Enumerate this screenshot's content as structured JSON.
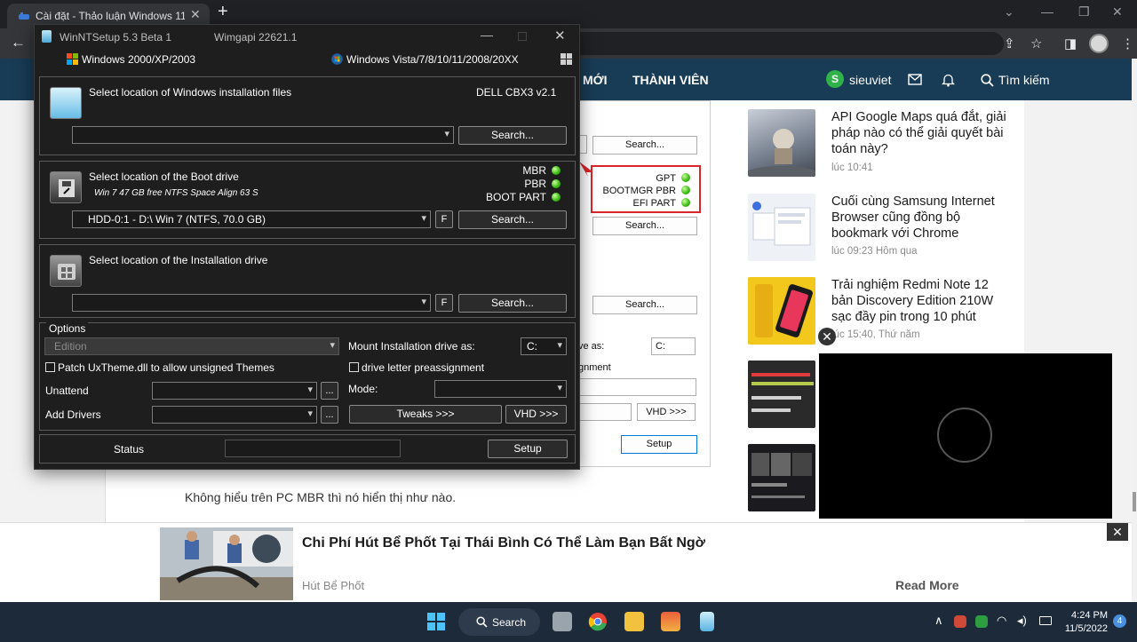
{
  "browser": {
    "tab_title": "Cài đặt - Thảo luận Windows 11",
    "new_tab": "+"
  },
  "site": {
    "nav": {
      "moi": "MỚI",
      "members": "THÀNH VIÊN",
      "search": "Tìm kiếm"
    },
    "user": {
      "initial": "S",
      "name": "sieuviet"
    },
    "post_text": "Không hiểu trên PC MBR thì nó hiển thị như nào.",
    "bg_window": {
      "search1": "Search...",
      "search2": "Search...",
      "search3": "Search...",
      "gpt": "GPT",
      "bootmgr_pbr": "BOOTMGR PBR",
      "efi_part": "EFI PART",
      "mount_as_partial": "ve as:",
      "drive_value": "C:",
      "assignment_partial": "gnment",
      "vhd": "VHD >>>",
      "setup": "Setup"
    },
    "news": [
      {
        "title": "API Google Maps quá đắt, giải pháp nào có thể giải quyết bài toán này?",
        "time": "lúc 10:41"
      },
      {
        "title": "Cuối cùng Samsung Internet Browser cũng đồng bộ bookmark với Chrome",
        "time": "lúc 09:23 Hôm qua"
      },
      {
        "title": "Trải nghiệm Redmi Note 12 bản Discovery Edition 210W sạc đầy pin trong 10 phút",
        "time": "lúc 15:40, Thứ năm"
      }
    ],
    "ad": {
      "title": "Chi Phí Hút Bể Phốt Tại Thái Bình Có Thể Làm Bạn Bất Ngờ",
      "source": "Hút Bể Phốt",
      "cta": "Read More"
    }
  },
  "winntsetup": {
    "title": "WinNTSetup 5.3 Beta 1",
    "wimgapi": "Wimgapi 22621.1",
    "os_legacy": "Windows 2000/XP/2003",
    "os_modern": "Windows Vista/7/8/10/11/2008/20XX",
    "install_files": {
      "label": "Select location of Windows installation files",
      "device": "DELL  CBX3    v2.1",
      "value": "",
      "search": "Search..."
    },
    "boot_drive": {
      "label": "Select location of the Boot drive",
      "sub": "Win 7 47 GB free NTFS Space Align  63 S",
      "mbr": "MBR",
      "pbr": "PBR",
      "boot_part": "BOOT PART",
      "value": "HDD-0:1 - D:\\ Win 7 (NTFS, 70.0 GB)",
      "f": "F",
      "search": "Search..."
    },
    "install_drive": {
      "label": "Select location of the Installation drive",
      "value": "",
      "f": "F",
      "search": "Search..."
    },
    "options": {
      "title": "Options",
      "edition_placeholder": "Edition",
      "mount_label": "Mount Installation drive as:",
      "mount_value": "C:",
      "patch_uxtheme": "Patch UxTheme.dll to allow unsigned Themes",
      "drive_letter": "drive letter preassignment",
      "unattend": "Unattend",
      "mode": "Mode:",
      "add_drivers": "Add Drivers",
      "ellipsis": "...",
      "tweaks": "Tweaks >>>",
      "vhd": "VHD >>>"
    },
    "status_label": "Status",
    "setup": "Setup"
  },
  "taskbar": {
    "search": "Search",
    "time": "4:24 PM",
    "date": "11/5/2022",
    "notifications": "4"
  }
}
